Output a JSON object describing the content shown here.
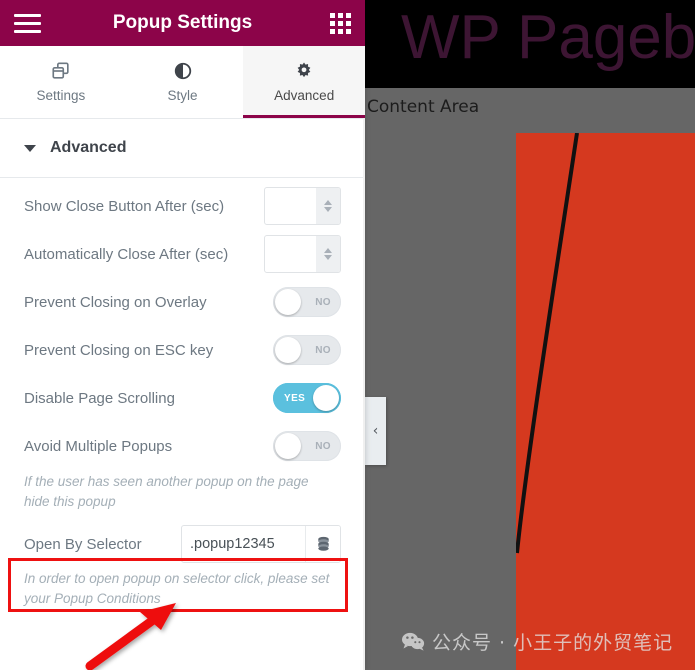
{
  "background": {
    "logo_text": "WP Pageb",
    "content_area_label": "Content Area",
    "black_header_color": "#000000",
    "page_background_color": "#666666",
    "block_color": "#d5391f",
    "collapse_tab_icon": "chevron-left-icon",
    "collapse_tab_glyph": "‹"
  },
  "watermark": {
    "icon": "wechat-icon",
    "text": "公众号 · 小王子的外贸笔记"
  },
  "panel": {
    "header": {
      "title": "Popup Settings",
      "menu_icon": "hamburger-menu-icon",
      "apps_icon": "grid-apps-icon",
      "background_color": "#8c0449"
    },
    "tabs": [
      {
        "label": "Settings",
        "icon": "windows-layers-icon",
        "active": false
      },
      {
        "label": "Style",
        "icon": "contrast-half-circle-icon",
        "active": false
      },
      {
        "label": "Advanced",
        "icon": "gear-icon",
        "active": true
      }
    ],
    "section": {
      "title": "Advanced",
      "caret_icon": "caret-down-icon",
      "expanded": true
    },
    "controls": [
      {
        "label": "Show Close Button After (sec)",
        "type": "number",
        "value": "",
        "placeholder": ""
      },
      {
        "label": "Automatically Close After (sec)",
        "type": "number",
        "value": "",
        "placeholder": ""
      },
      {
        "label": "Prevent Closing on Overlay",
        "type": "switch",
        "state": "NO",
        "on": false
      },
      {
        "label": "Prevent Closing on ESC key",
        "type": "switch",
        "state": "NO",
        "on": false
      },
      {
        "label": "Disable Page Scrolling",
        "type": "switch",
        "state": "YES",
        "on": true
      },
      {
        "label": "Avoid Multiple Popups",
        "type": "switch",
        "state": "NO",
        "on": false
      }
    ],
    "help_avoid_popups": "If the user has seen another popup on the page hide this popup",
    "selector": {
      "label": "Open By Selector",
      "value": ".popup12345",
      "placeholder": "",
      "dynamic_icon": "database-stack-icon",
      "help": "In order to open popup on selector click, please set your Popup Conditions"
    }
  },
  "annotation": {
    "highlight_color": "#ee1111",
    "arrow_color": "#ee1111",
    "target": "open-by-selector-row"
  }
}
